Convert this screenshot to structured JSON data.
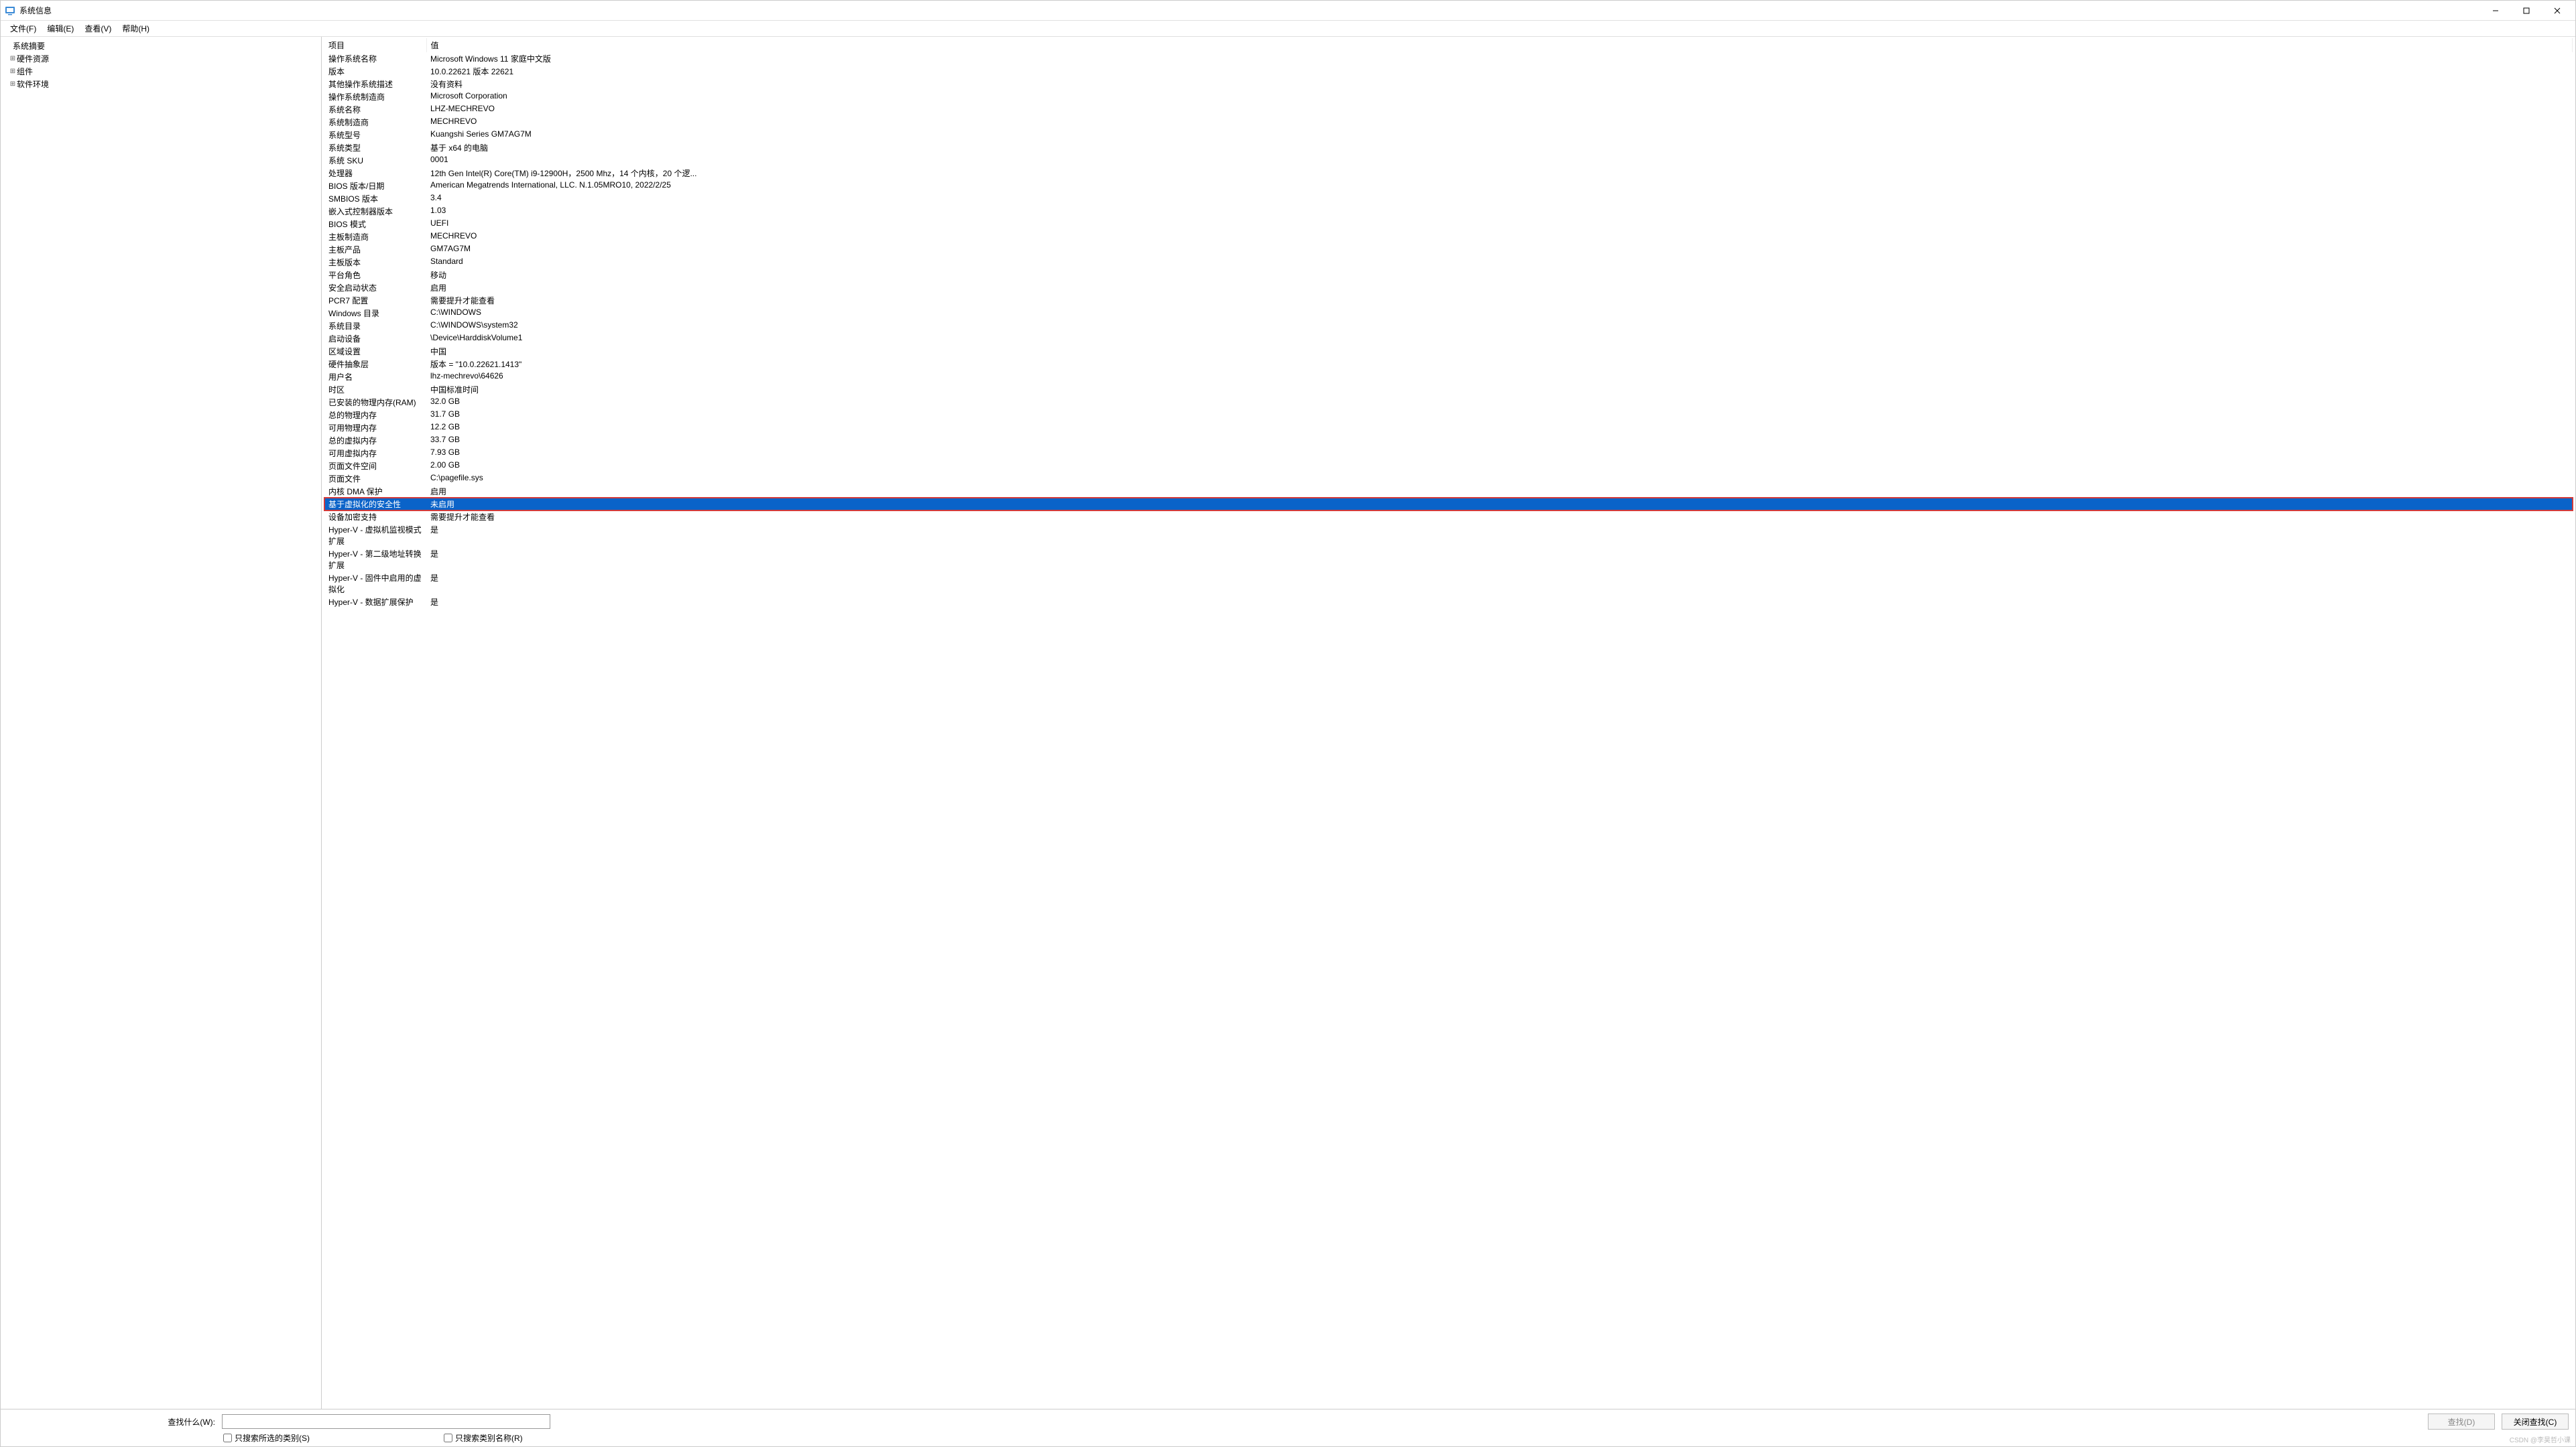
{
  "window": {
    "title": "系统信息"
  },
  "menu": {
    "file": "文件(F)",
    "edit": "编辑(E)",
    "view": "查看(V)",
    "help": "帮助(H)"
  },
  "tree": {
    "root": "系统摘要",
    "hardware": "硬件资源",
    "components": "组件",
    "software": "软件环境"
  },
  "details": {
    "header_key": "项目",
    "header_val": "值",
    "rows": [
      {
        "k": "操作系统名称",
        "v": "Microsoft Windows 11 家庭中文版"
      },
      {
        "k": "版本",
        "v": "10.0.22621 版本 22621"
      },
      {
        "k": "其他操作系统描述",
        "v": "没有资料"
      },
      {
        "k": "操作系统制造商",
        "v": "Microsoft Corporation"
      },
      {
        "k": "系统名称",
        "v": "LHZ-MECHREVO"
      },
      {
        "k": "系统制造商",
        "v": "MECHREVO"
      },
      {
        "k": "系统型号",
        "v": "Kuangshi Series GM7AG7M"
      },
      {
        "k": "系统类型",
        "v": "基于 x64 的电脑"
      },
      {
        "k": "系统 SKU",
        "v": "0001"
      },
      {
        "k": "处理器",
        "v": "12th Gen Intel(R) Core(TM) i9-12900H，2500 Mhz，14 个内核，20 个逻..."
      },
      {
        "k": "BIOS 版本/日期",
        "v": "American Megatrends International, LLC. N.1.05MRO10, 2022/2/25"
      },
      {
        "k": "SMBIOS 版本",
        "v": "3.4"
      },
      {
        "k": "嵌入式控制器版本",
        "v": "1.03"
      },
      {
        "k": "BIOS 模式",
        "v": "UEFI"
      },
      {
        "k": "主板制造商",
        "v": "MECHREVO"
      },
      {
        "k": "主板产品",
        "v": "GM7AG7M"
      },
      {
        "k": "主板版本",
        "v": "Standard"
      },
      {
        "k": "平台角色",
        "v": "移动"
      },
      {
        "k": "安全启动状态",
        "v": "启用"
      },
      {
        "k": "PCR7 配置",
        "v": "需要提升才能查看"
      },
      {
        "k": "Windows 目录",
        "v": "C:\\WINDOWS"
      },
      {
        "k": "系统目录",
        "v": "C:\\WINDOWS\\system32"
      },
      {
        "k": "启动设备",
        "v": "\\Device\\HarddiskVolume1"
      },
      {
        "k": "区域设置",
        "v": "中国"
      },
      {
        "k": "硬件抽象层",
        "v": "版本 = \"10.0.22621.1413\""
      },
      {
        "k": "用户名",
        "v": "lhz-mechrevo\\64626"
      },
      {
        "k": "时区",
        "v": "中国标准时间"
      },
      {
        "k": "已安装的物理内存(RAM)",
        "v": "32.0 GB"
      },
      {
        "k": "总的物理内存",
        "v": "31.7 GB"
      },
      {
        "k": "可用物理内存",
        "v": "12.2 GB"
      },
      {
        "k": "总的虚拟内存",
        "v": "33.7 GB"
      },
      {
        "k": "可用虚拟内存",
        "v": "7.93 GB"
      },
      {
        "k": "页面文件空间",
        "v": "2.00 GB"
      },
      {
        "k": "页面文件",
        "v": "C:\\pagefile.sys"
      },
      {
        "k": "内核 DMA 保护",
        "v": "启用"
      },
      {
        "k": "基于虚拟化的安全性",
        "v": "未启用",
        "hl": true
      },
      {
        "k": "设备加密支持",
        "v": "需要提升才能查看"
      },
      {
        "k": "Hyper-V - 虚拟机监视模式扩展",
        "v": "是"
      },
      {
        "k": "Hyper-V - 第二级地址转换扩展",
        "v": "是"
      },
      {
        "k": "Hyper-V - 固件中启用的虚拟化",
        "v": "是"
      },
      {
        "k": "Hyper-V - 数据扩展保护",
        "v": "是"
      }
    ]
  },
  "search": {
    "label": "查找什么(W):",
    "find": "查找(D)",
    "close_find": "关闭查找(C)",
    "only_selected": "只搜索所选的类别(S)",
    "only_category": "只搜索类别名称(R)",
    "value": ""
  },
  "watermark": "CSDN @李昊哲小课"
}
